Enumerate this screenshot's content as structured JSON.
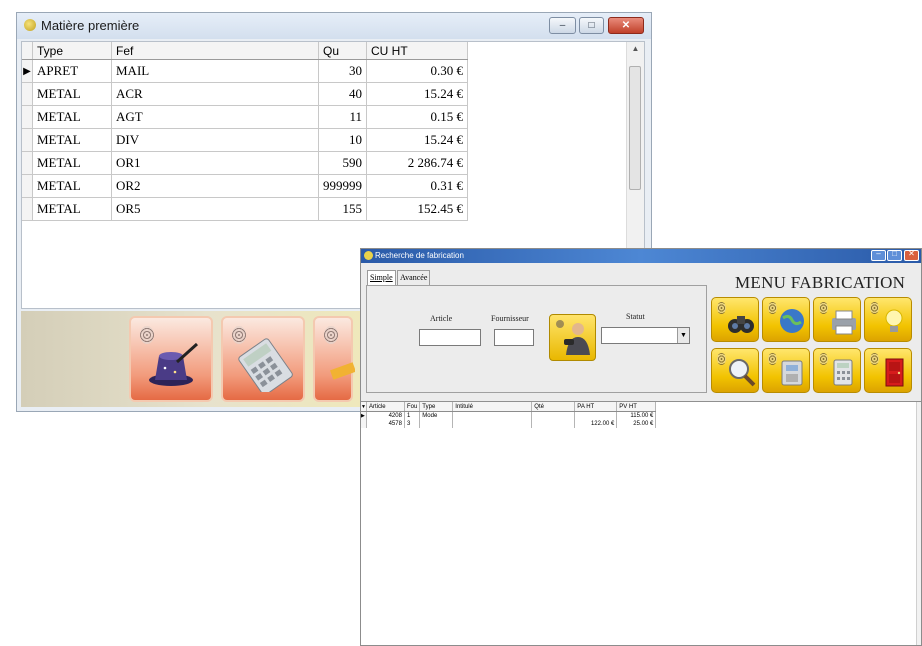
{
  "window_main": {
    "title": "Matière première",
    "controls": {
      "minimize": "–",
      "maximize": "□",
      "close": "✕"
    },
    "grid": {
      "columns": [
        "Type",
        "Fef",
        "Qu",
        "CU HT"
      ],
      "rows": [
        {
          "type": "APRET",
          "ref": "MAIL",
          "qty": "30",
          "cu_ht": "0.30 €",
          "current": true
        },
        {
          "type": "METAL",
          "ref": "ACR",
          "qty": "40",
          "cu_ht": "15.24 €"
        },
        {
          "type": "METAL",
          "ref": "AGT",
          "qty": "11",
          "cu_ht": "0.15 €"
        },
        {
          "type": "METAL",
          "ref": "DIV",
          "qty": "10",
          "cu_ht": "15.24 €"
        },
        {
          "type": "METAL",
          "ref": "OR1",
          "qty": "590",
          "cu_ht": "2 286.74 €"
        },
        {
          "type": "METAL",
          "ref": "OR2",
          "qty": "999999",
          "cu_ht": "0.31 €"
        },
        {
          "type": "METAL",
          "ref": "OR5",
          "qty": "155",
          "cu_ht": "152.45 €"
        }
      ],
      "row_indicator": "▶"
    },
    "toolbar": {
      "buttons": [
        "magic-hat-icon",
        "calculator-icon",
        "pencil-icon"
      ]
    }
  },
  "window_fab": {
    "title": "Recherche de fabrication",
    "controls": {
      "minimize": "–",
      "maximize": "□",
      "close": "✕"
    },
    "tabs": [
      "Simple",
      "Avancée"
    ],
    "labels": {
      "article": "Article",
      "fournisseur": "Fournisseur",
      "statut": "Statut"
    },
    "menu_title": "MENU FABRICATION",
    "menu_buttons": [
      "binoculars-icon",
      "globe-icon",
      "printer-icon",
      "lightbulb-icon",
      "magnifier-icon",
      "machine-icon",
      "calculator-icon",
      "exit-door-icon"
    ],
    "grid": {
      "columns": [
        "Article",
        "Fou",
        "Type",
        "Intitulé",
        "Qté",
        "PA HT",
        "PV HT"
      ],
      "rows": [
        {
          "article": "4208",
          "fou": "1",
          "type": "Mode",
          "label": "",
          "qty": "",
          "pa": "",
          "pv": "115.00 €"
        },
        {
          "article": "4578",
          "fou": "3",
          "type": "",
          "label": "",
          "qty": "",
          "pa": "122.00 €",
          "pv": "25.00 €"
        }
      ]
    }
  },
  "colors": {
    "accent_red": "#c0402a",
    "title_blue": "#2a5aa8",
    "button_yellow": "#f2c300",
    "button_orange": "#f29b7c"
  }
}
